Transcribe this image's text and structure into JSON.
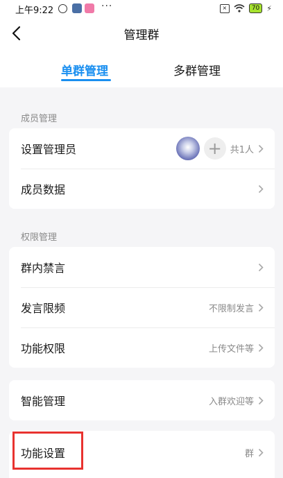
{
  "status_bar": {
    "time": "上午9:22",
    "more": "···",
    "battery": "70",
    "icons": [
      "alarm-icon",
      "app-icon",
      "app-icon",
      "notification-box-icon",
      "wifi-icon",
      "battery-icon",
      "charging-icon"
    ]
  },
  "header": {
    "title": "管理群",
    "tabs": [
      {
        "label": "单群管理",
        "active": true
      },
      {
        "label": "多群管理",
        "active": false
      }
    ]
  },
  "sections": {
    "members": {
      "label": "成员管理",
      "rows": [
        {
          "label": "设置管理员",
          "value": "共1人"
        },
        {
          "label": "成员数据",
          "value": ""
        }
      ]
    },
    "permissions": {
      "label": "权限管理",
      "rows": [
        {
          "label": "群内禁言",
          "value": ""
        },
        {
          "label": "发言限频",
          "value": "不限制发言"
        },
        {
          "label": "功能权限",
          "value": "上传文件等"
        }
      ]
    },
    "smart": {
      "rows": [
        {
          "label": "智能管理",
          "value": "入群欢迎等"
        }
      ]
    },
    "function": {
      "rows": [
        {
          "label": "功能设置",
          "value": "群"
        }
      ]
    }
  },
  "colors": {
    "accent": "#1a8ff0",
    "highlight": "#e8322f",
    "background": "#f5f5f7"
  }
}
